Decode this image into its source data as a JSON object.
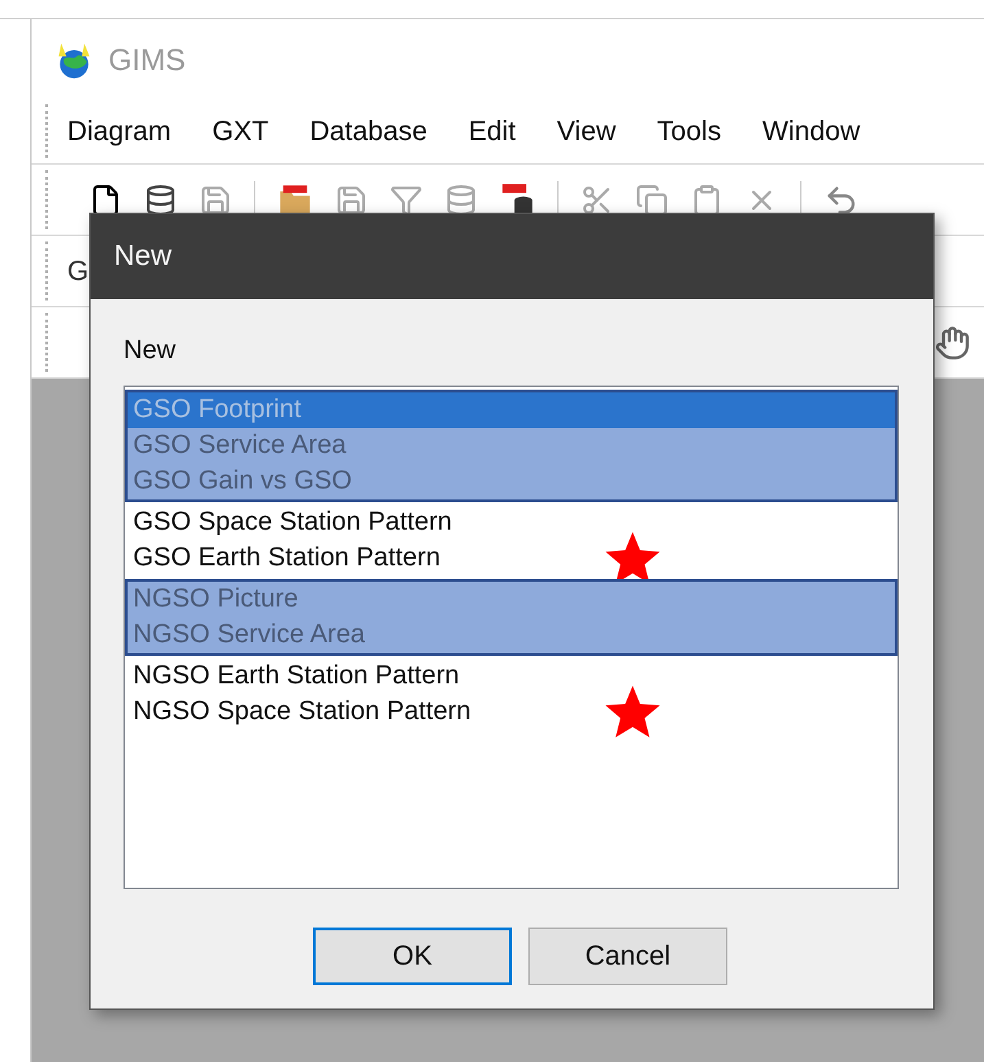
{
  "app": {
    "title": "GIMS",
    "menu": [
      "Diagram",
      "GXT",
      "Database",
      "Edit",
      "View",
      "Tools",
      "Window"
    ],
    "toolbar_2_text": "G"
  },
  "dialog": {
    "title": "New",
    "label": "New",
    "groups": [
      {
        "selected": true,
        "starred": false,
        "items": [
          {
            "label": "GSO Footprint",
            "focused": true
          },
          {
            "label": "GSO Service Area",
            "focused": false
          },
          {
            "label": "GSO Gain vs GSO",
            "focused": false
          }
        ]
      },
      {
        "selected": false,
        "starred": true,
        "items": [
          {
            "label": "GSO Space Station Pattern",
            "focused": false
          },
          {
            "label": "GSO Earth Station Pattern",
            "focused": false
          }
        ]
      },
      {
        "selected": true,
        "starred": false,
        "items": [
          {
            "label": "NGSO Picture",
            "focused": false
          },
          {
            "label": "NGSO Service Area",
            "focused": false
          }
        ]
      },
      {
        "selected": false,
        "starred": true,
        "items": [
          {
            "label": "NGSO Earth Station Pattern",
            "focused": false
          },
          {
            "label": "NGSO Space Station Pattern",
            "focused": false
          }
        ]
      }
    ],
    "buttons": [
      {
        "label": "OK",
        "default": true
      },
      {
        "label": "Cancel",
        "default": false
      }
    ]
  }
}
